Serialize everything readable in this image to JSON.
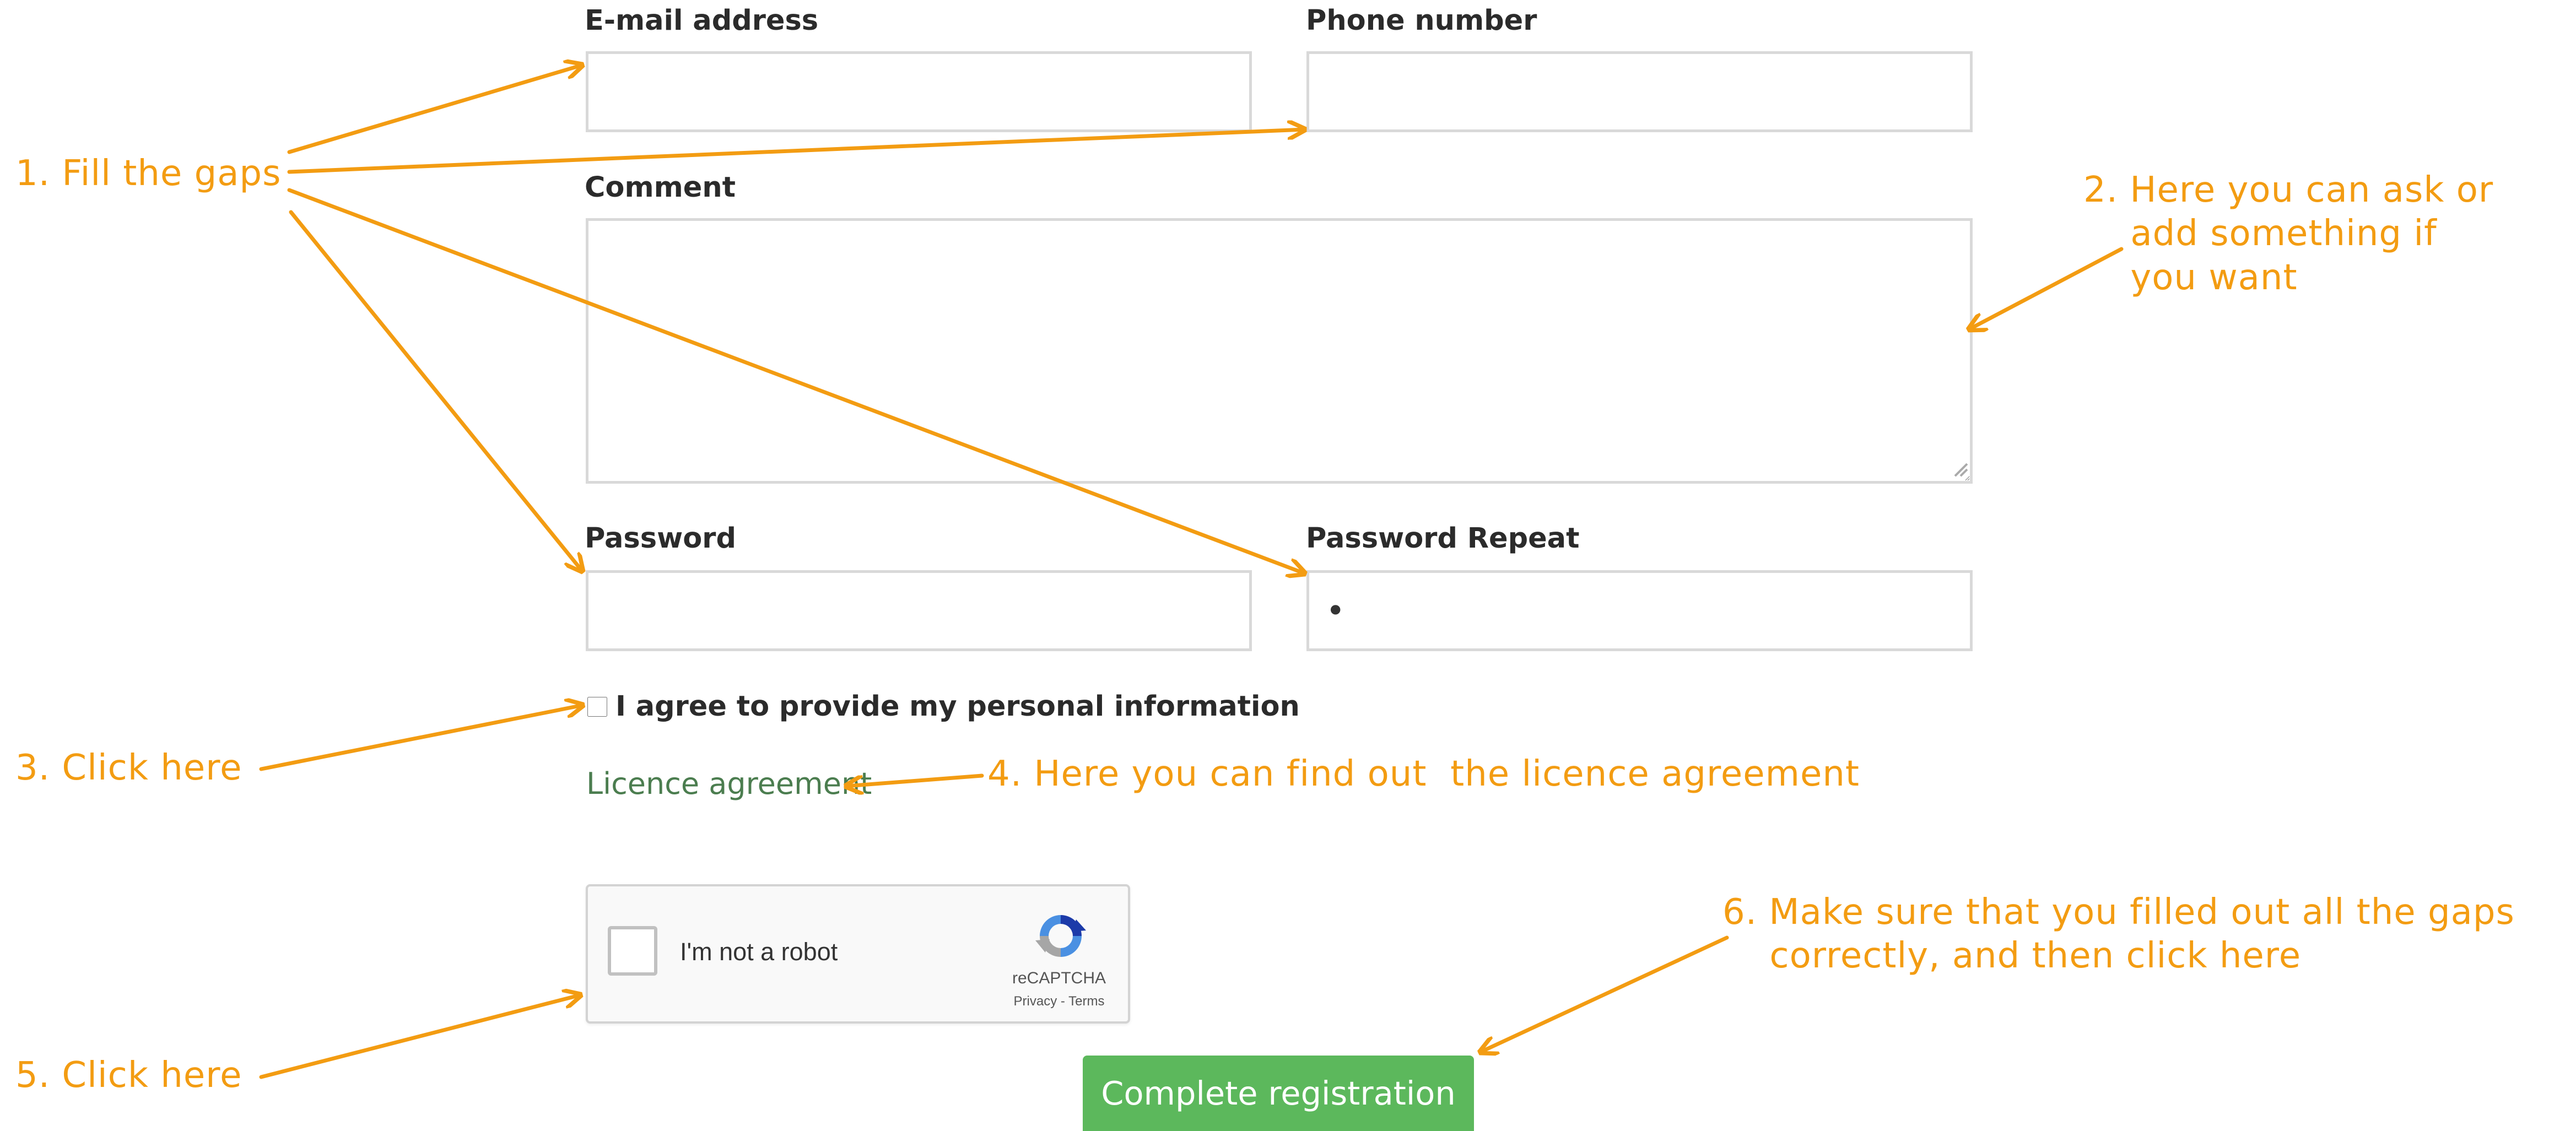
{
  "form": {
    "email_label": "E-mail address",
    "email_value": "",
    "phone_label": "Phone number",
    "phone_value": "",
    "comment_label": "Comment",
    "comment_value": "",
    "password_label": "Password",
    "password_value": "",
    "password_repeat_label": "Password Repeat",
    "password_repeat_value": "•",
    "agree_text": "I agree to provide my personal information",
    "licence_link": "Licence agreement",
    "recaptcha": {
      "text": "I'm not a robot",
      "brand": "reCAPTCHA",
      "links": "Privacy - Terms"
    },
    "submit_label": "Complete registration"
  },
  "annotations": {
    "note1": "1. Fill the gaps",
    "note2": "2. Here you can ask or\n    add something if\n    you want",
    "note3": "3. Click here",
    "note4": "4. Here you can find out  the licence agreement",
    "note5": "5. Click here",
    "note6": "6. Make sure that you filled out all the gaps\n    correctly, and then click here"
  },
  "colors": {
    "annotation": "#f39c12",
    "button": "#5cb85c",
    "link": "#4b7d4f"
  }
}
